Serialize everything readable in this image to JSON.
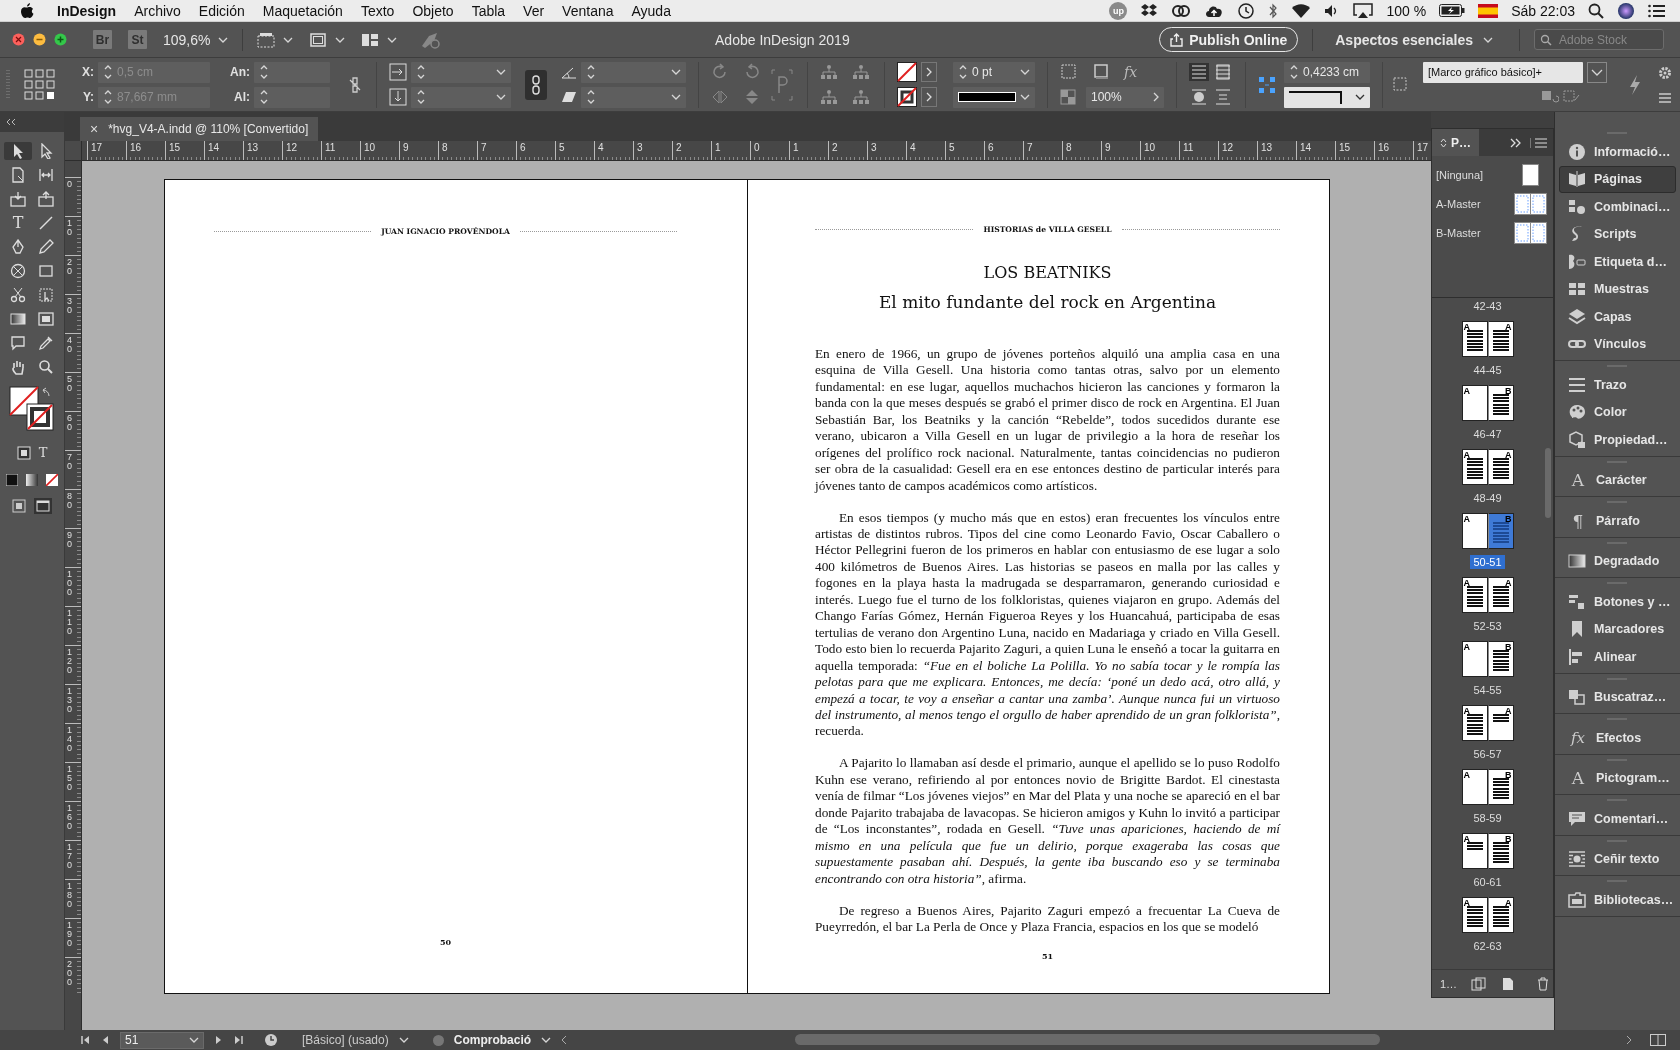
{
  "menu_bar": {
    "app": "InDesign",
    "menus": [
      "Archivo",
      "Edición",
      "Maquetación",
      "Texto",
      "Objeto",
      "Tabla",
      "Ver",
      "Ventana",
      "Ayuda"
    ],
    "badge": "up",
    "battery": "100 %",
    "clock": "Sáb 22:03"
  },
  "app_bar": {
    "bridge": "Br",
    "stock": "St",
    "zoom": "109,6%",
    "title": "Adobe InDesign 2019",
    "publish": "Publish Online",
    "workspace": "Aspectos esenciales",
    "search": {
      "placeholder": "Adobe Stock"
    }
  },
  "control_panel": {
    "position_fields": [
      {
        "label": "X:",
        "value": "0,5 cm",
        "disabled": true
      },
      {
        "label": "Y:",
        "value": "87,667 mm",
        "disabled": true
      }
    ],
    "size_fields": [
      {
        "label": "An:"
      },
      {
        "label": "Al:"
      }
    ],
    "stroke_weight": "0 pt",
    "effects_glyph": "fx",
    "opacity": "100%",
    "spacing": "0,4233 cm",
    "object_style": "[Marco gráfico básico]+"
  },
  "tools": {
    "type_glyph": "T",
    "format_glyph": "T"
  },
  "document": {
    "tab": {
      "close": "×",
      "title": "*hvg_V4-A.indd @ 110% [Convertido]"
    },
    "h_ruler": [
      "17",
      "16",
      "15",
      "14",
      "13",
      "12",
      "11",
      "10",
      "9",
      "8",
      "7",
      "6",
      "5",
      "4",
      "3",
      "2",
      "1",
      "0",
      "1",
      "2",
      "3",
      "4",
      "5",
      "6",
      "7",
      "8",
      "9",
      "10",
      "11",
      "12",
      "13",
      "14",
      "15",
      "16",
      "17"
    ],
    "v_ruler": [
      "0",
      "10",
      "20",
      "30",
      "40",
      "50",
      "60",
      "70",
      "80",
      "90",
      "100",
      "110",
      "120",
      "130",
      "140",
      "150",
      "160",
      "170",
      "180",
      "190",
      "200"
    ],
    "left_page": {
      "running_head": "JUAN IGNACIO PROVÉNDOLA",
      "number": "50"
    },
    "right_page": {
      "running_head": "HISTORIAS de VILLA GESELL",
      "title": "LOS BEATNIKS",
      "subtitle": "El mito fundante del rock en Argentina",
      "number": "51",
      "paragraphs": [
        {
          "indent": false,
          "text": "En enero de 1966, un grupo de jóvenes porteños alquiló una amplia casa en una esquina de Villa Gesell. Una historia como tantas otras, salvo por un elemento fundamental: en ese lugar, aquellos muchachos hicieron las canciones y formaron la banda con la que meses después se grabó el primer disco de rock en Argentina. El Juan Sebastián Bar, los Beatniks y la canción “Rebelde”, todos sucedidos durante ese verano, ubicaron a Villa Gesell en un lugar de privilegio a la hora de reseñar los orígenes del prolífico rock nacional. Naturalmente, tantas coincidencias no pudieron ser obra de la casualidad: Gesell era en ese entonces destino de particular interés para jóvenes tanto de campos académicos como artísticos."
        },
        {
          "indent": true,
          "text": "En esos tiempos (y mucho más que en estos) eran frecuentes los vínculos entre artistas de distintos rubros. Tipos del cine como Leonardo Favio, Oscar Caballero o Héctor Pellegrini fueron de los primeros en hablar con entusiasmo de ese lugar a solo 400 kilómetros de Buenos Aires. Las historias se paseos en malla por las calles y fogones en la playa hasta la madrugada se desparramaron, generando curiosidad e interés. Luego fue el turno de los folkloristas, quienes viajaron en grupo. Además del Chango Farías Gómez, Hernán Figueroa Reyes y los Huancahuá, participaba de esas tertulias de verano don Argentino Luna, nacido en Madariaga y criado en Villa Gesell. Todo esto bien lo recuerda Pajarito Zaguri, a quien Luna le enseñó a tocar la guitarra en aquella temporada: *“Fue en el boliche La Polilla. Yo no sabía tocar y le rompía las pelotas para que me explicara. Entonces, me decía: ‘poné un dedo acá, otro allá, y empezá a tocar, te voy a enseñar a cantar una zamba’. Aunque nunca fui un virtuoso del instrumento, al menos tengo el orgullo de haber aprendido de un gran folklorista”*, recuerda."
        },
        {
          "indent": true,
          "text": "A Pajarito lo llamaban así desde el primario, aunque el apellido se lo puso Rodolfo Kuhn ese verano, refiriendo al por entonces novio de Brigitte Bardot. El cinestasta venía de filmar “Los jóvenes viejos” en Mar del Plata y una noche se apareció en el bar donde Pajarito trabajaba de lavacopas. Se hicieron amigos y Kuhn lo invitó a participar de “Los inconstantes”, rodada en Gesell. *“Tuve unas apariciones, haciendo de mí mismo en una película que fue un delirio, porque exageraba las cosas que supuestamente pasaban ahí. Después, la gente iba buscando eso y se terminaba encontrando con otra historia”*, afirma."
        },
        {
          "indent": true,
          "text": "De regreso a Buenos Aires, Pajarito Zaguri empezó a frecuentar La Cueva de Pueyrredón, el bar La Perla de Once y Plaza Francia, espacios en los que se modeló"
        }
      ]
    }
  },
  "pages_panel": {
    "tab": "P…",
    "masters": [
      {
        "label": "[Ninguna]",
        "kind": "single"
      },
      {
        "label": "A-Master",
        "kind": "spread"
      },
      {
        "label": "B-Master",
        "kind": "spread"
      }
    ],
    "spreads": [
      {
        "label": "42-43",
        "selected": false
      },
      {
        "label": "44-45",
        "selected": false,
        "pages": [
          {
            "master": "A",
            "kind": "text",
            "selected": false
          },
          {
            "master": "A",
            "kind": "text",
            "selected": false
          }
        ]
      },
      {
        "label": "46-47",
        "selected": false,
        "pages": [
          {
            "master": "A",
            "kind": "blank",
            "selected": false
          },
          {
            "master": "B",
            "kind": "text",
            "selected": false
          }
        ]
      },
      {
        "label": "48-49",
        "selected": false,
        "pages": [
          {
            "master": "A",
            "kind": "text",
            "selected": false
          },
          {
            "master": "A",
            "kind": "text",
            "selected": false
          }
        ]
      },
      {
        "label": "50-51",
        "selected": true,
        "pages": [
          {
            "master": "A",
            "kind": "blank",
            "selected": false
          },
          {
            "master": "B",
            "kind": "text",
            "selected": true
          }
        ]
      },
      {
        "label": "52-53",
        "selected": false,
        "pages": [
          {
            "master": "A",
            "kind": "text",
            "selected": false
          },
          {
            "master": "A",
            "kind": "text",
            "selected": false
          }
        ]
      },
      {
        "label": "54-55",
        "selected": false,
        "pages": [
          {
            "master": "A",
            "kind": "blank",
            "selected": false
          },
          {
            "master": "B",
            "kind": "text",
            "selected": false
          }
        ]
      },
      {
        "label": "56-57",
        "selected": false,
        "pages": [
          {
            "master": "A",
            "kind": "text",
            "selected": false
          },
          {
            "master": "A",
            "kind": "partial",
            "selected": false
          }
        ]
      },
      {
        "label": "58-59",
        "selected": false,
        "pages": [
          {
            "master": "A",
            "kind": "blank",
            "selected": false
          },
          {
            "master": "B",
            "kind": "text",
            "selected": false
          }
        ]
      },
      {
        "label": "60-61",
        "selected": false,
        "pages": [
          {
            "master": "A",
            "kind": "partial",
            "selected": false
          },
          {
            "master": "B",
            "kind": "text",
            "selected": false
          }
        ]
      },
      {
        "label": "62-63",
        "selected": false,
        "pages": [
          {
            "master": "A",
            "kind": "text",
            "selected": false
          },
          {
            "master": "A",
            "kind": "text",
            "selected": false
          }
        ]
      }
    ],
    "footer": "1…"
  },
  "dock": {
    "groups": [
      [
        {
          "label": "Informació…",
          "selected": false
        },
        {
          "label": "Páginas",
          "selected": true
        },
        {
          "label": "Combinaci…",
          "selected": false
        },
        {
          "label": "Scripts",
          "selected": false
        },
        {
          "label": "Etiqueta d…",
          "selected": false
        },
        {
          "label": "Muestras",
          "selected": false
        },
        {
          "label": "Capas",
          "selected": false
        },
        {
          "label": "Vínculos",
          "selected": false
        }
      ],
      [
        {
          "label": "Trazo",
          "selected": false
        },
        {
          "label": "Color",
          "selected": false
        },
        {
          "label": "Propiedad…",
          "selected": false
        }
      ],
      [
        {
          "label": "Carácter",
          "selected": false,
          "glyph": "A"
        }
      ],
      [
        {
          "label": "Párrafo",
          "selected": false,
          "glyph": "¶"
        }
      ],
      [
        {
          "label": "Degradado",
          "selected": false
        }
      ],
      [
        {
          "label": "Botones y …",
          "selected": false
        },
        {
          "label": "Marcadores",
          "selected": false
        },
        {
          "label": "Alinear",
          "selected": false
        }
      ],
      [
        {
          "label": "Buscatraz…",
          "selected": false
        }
      ],
      [
        {
          "label": "Efectos",
          "selected": false,
          "glyph": "fx"
        }
      ],
      [
        {
          "label": "Pictogram…",
          "selected": false,
          "glyph": "A"
        }
      ],
      [
        {
          "label": "Comentari…",
          "selected": false
        }
      ],
      [
        {
          "label": "Ceñir texto",
          "selected": false
        }
      ],
      [
        {
          "label": "Bibliotecas…",
          "selected": false
        }
      ]
    ]
  },
  "status_bar": {
    "page": "51",
    "master": "[Básico] (usado)",
    "preflight": "Comprobació"
  }
}
